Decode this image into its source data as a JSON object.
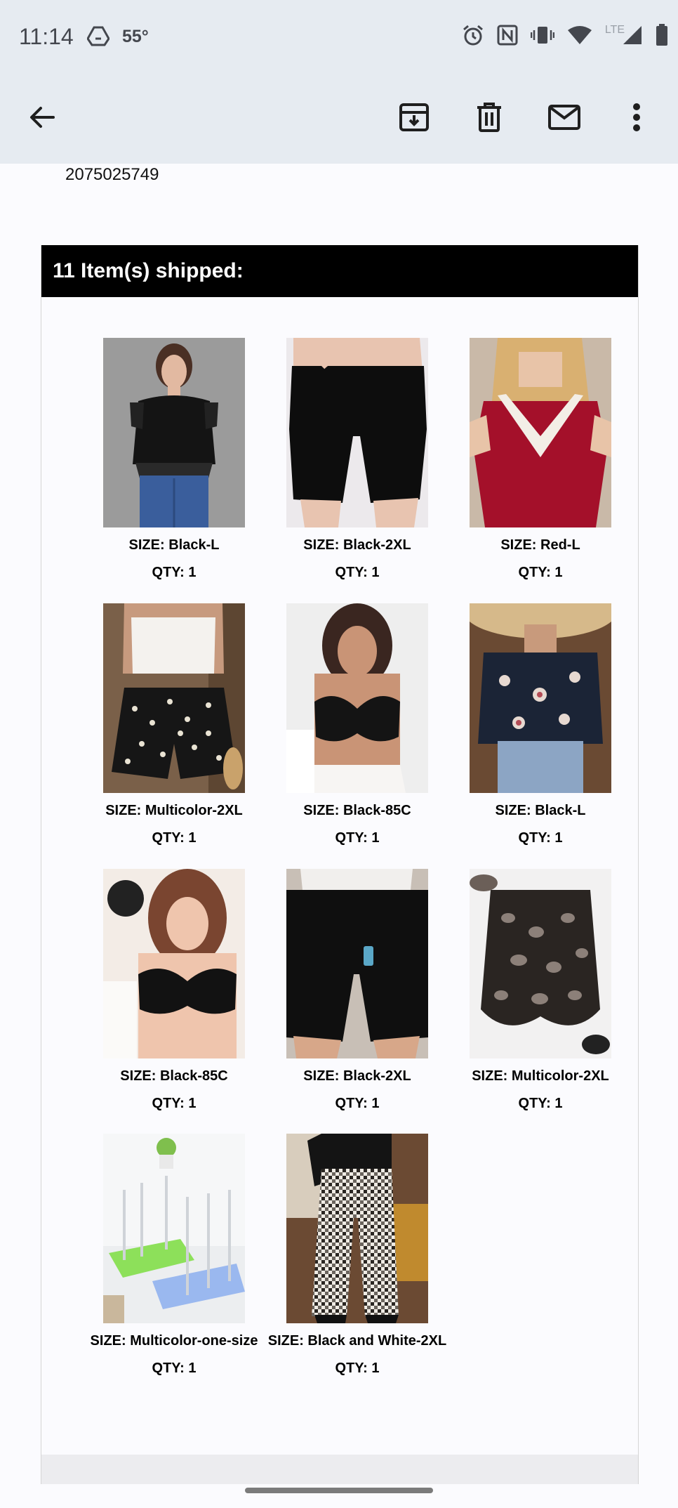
{
  "status_bar": {
    "time": "11:14",
    "temperature": "55°",
    "network_label": "LTE"
  },
  "app_bar": {
    "back_icon": "arrow-back-icon",
    "archive_icon": "archive-icon",
    "delete_icon": "trash-icon",
    "mark_unread_icon": "mail-icon",
    "more_icon": "more-vert-icon"
  },
  "email": {
    "order_number": "2075025749",
    "shipped_header": "11 Item(s) shipped:",
    "items": [
      {
        "size": "SIZE: Black-L",
        "qty": "QTY: 1",
        "image": "black-lace-top"
      },
      {
        "size": "SIZE: Black-2XL",
        "qty": "QTY: 1",
        "image": "black-biker-shorts"
      },
      {
        "size": "SIZE: Red-L",
        "qty": "QTY: 1",
        "image": "red-lace-top"
      },
      {
        "size": "SIZE: Multicolor-2XL",
        "qty": "QTY: 1",
        "image": "floral-shorts"
      },
      {
        "size": "SIZE: Black-85C",
        "qty": "QTY: 1",
        "image": "black-bra"
      },
      {
        "size": "SIZE: Black-L",
        "qty": "QTY: 1",
        "image": "floral-lace-blouse"
      },
      {
        "size": "SIZE: Black-85C",
        "qty": "QTY: 1",
        "image": "black-lace-bra"
      },
      {
        "size": "SIZE: Black-2XL",
        "qty": "QTY: 1",
        "image": "black-pocket-shorts"
      },
      {
        "size": "SIZE: Multicolor-2XL",
        "qty": "QTY: 1",
        "image": "leopard-skirt"
      },
      {
        "size": "SIZE: Multicolor-one-size",
        "qty": "QTY: 1",
        "image": "drying-racks"
      },
      {
        "size": "SIZE: Black and White-2XL",
        "qty": "QTY: 1",
        "image": "gingham-pants"
      }
    ]
  },
  "colors": {
    "app_bar_bg": "#e6ebf1",
    "header_bg": "#000000",
    "header_text": "#ffffff",
    "page_bg": "#fbfbfe"
  }
}
